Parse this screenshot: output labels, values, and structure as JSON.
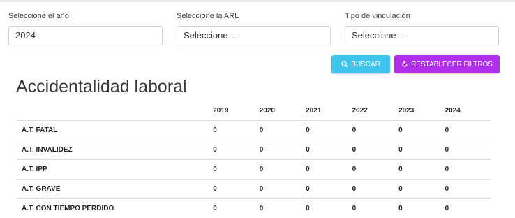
{
  "filters": {
    "year_label": "Seleccione el año",
    "year_value": "2024",
    "arl_label": "Seleccione la ARL",
    "arl_value": "Seleccione --",
    "link_label": "Tipo de vinculación",
    "link_value": "Seleccione --"
  },
  "actions": {
    "search_label": "BUSCAR",
    "reset_label": "RESTABLECER FILTROS"
  },
  "page": {
    "title": "Accidentalidad laboral"
  },
  "table": {
    "years": [
      "2019",
      "2020",
      "2021",
      "2022",
      "2023",
      "2024"
    ],
    "rows": [
      {
        "label": "A.T. FATAL",
        "values": [
          "0",
          "0",
          "0",
          "0",
          "0",
          "0"
        ]
      },
      {
        "label": "A.T. INVALIDEZ",
        "values": [
          "0",
          "0",
          "0",
          "0",
          "0",
          "0"
        ]
      },
      {
        "label": "A.T. IPP",
        "values": [
          "0",
          "0",
          "0",
          "0",
          "0",
          "0"
        ]
      },
      {
        "label": "A.T. GRAVE",
        "values": [
          "0",
          "0",
          "0",
          "0",
          "0",
          "0"
        ]
      },
      {
        "label": "A.T. CON TIEMPO PERDIDO",
        "values": [
          "0",
          "0",
          "0",
          "0",
          "0",
          "0"
        ]
      }
    ]
  }
}
